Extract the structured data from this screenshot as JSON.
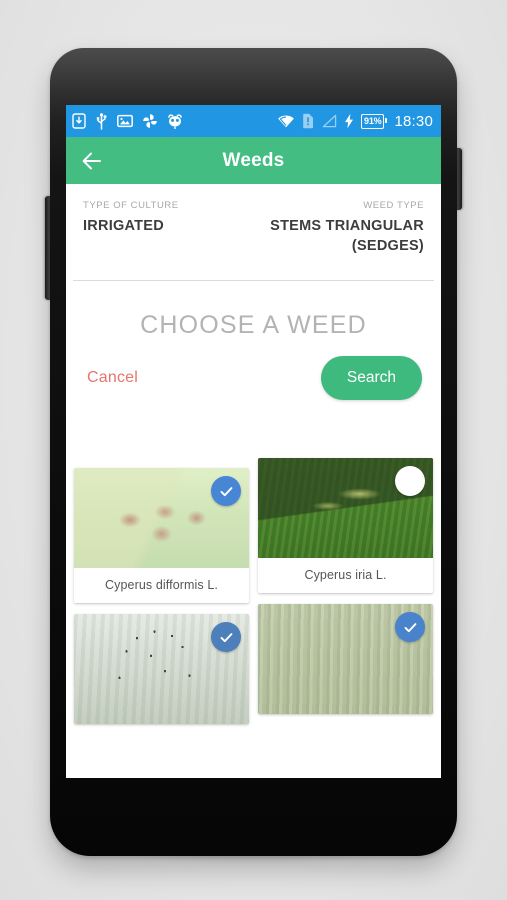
{
  "status_bar": {
    "icons_left": [
      "sd-card-icon",
      "usb-icon",
      "screenshot-icon",
      "pinwheel-icon",
      "owl-icon"
    ],
    "icons_right": [
      "wifi-icon",
      "sim-alert-icon",
      "signal-icon",
      "charging-bolt-icon"
    ],
    "battery_level": "91%",
    "time": "18:30",
    "background": "#2196e3"
  },
  "app_bar": {
    "back_icon": "back-arrow-icon",
    "title": "Weeds",
    "background": "#43bd82"
  },
  "meta": {
    "culture_label": "TYPE OF CULTURE",
    "culture_value": "IRRIGATED",
    "weed_type_label": "WEED TYPE",
    "weed_type_value": "STEMS TRIANGULAR (SEDGES)"
  },
  "main": {
    "heading": "CHOOSE A WEED",
    "cancel_label": "Cancel",
    "search_label": "Search",
    "cancel_color": "#e8746c",
    "search_color": "#3fba7f"
  },
  "weeds": {
    "left": [
      {
        "name": "Cyperus difformis L.",
        "selected": "selected",
        "photo": "ph-difformis"
      },
      {
        "name": "",
        "selected": "selected",
        "photo": "ph-seeds"
      }
    ],
    "right": [
      {
        "name": "Cyperus iria L.",
        "selected": "unselected",
        "photo": "ph-iria"
      },
      {
        "name": "",
        "selected": "selected",
        "photo": "ph-grass"
      }
    ]
  },
  "nav_bar": {
    "back": "nav-back-icon",
    "home": "nav-home-icon",
    "recents": "nav-recents-icon"
  }
}
